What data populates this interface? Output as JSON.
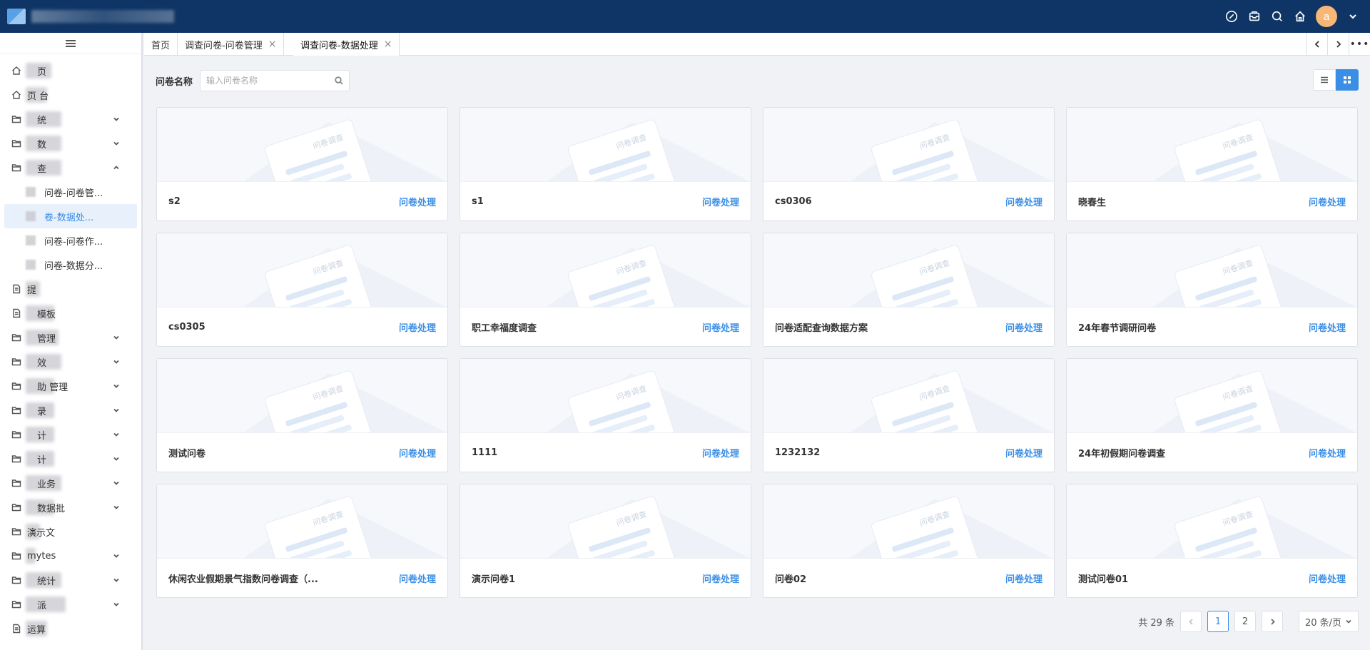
{
  "header": {
    "avatar_letter": "a",
    "icons": [
      "compass-icon",
      "inbox-icon",
      "search-icon",
      "home-icon",
      "chevron-down-icon"
    ]
  },
  "sidebar": {
    "items": [
      {
        "label": "页",
        "icon": "home-icon",
        "expandable": false
      },
      {
        "label": "页    台",
        "icon": "home-icon",
        "expandable": false
      },
      {
        "label": "统",
        "icon": "folder-icon",
        "expandable": true
      },
      {
        "label": "数",
        "icon": "folder-icon",
        "expandable": true
      },
      {
        "label": "查",
        "icon": "folder-icon",
        "expandable": true,
        "expanded": true
      },
      {
        "label": "模板",
        "icon": "document-icon",
        "expandable": false
      },
      {
        "label": "管理",
        "icon": "folder-icon",
        "expandable": true
      },
      {
        "label": "效",
        "icon": "folder-icon",
        "expandable": true
      },
      {
        "label": "助    管理",
        "icon": "folder-icon",
        "expandable": true
      },
      {
        "label": "录",
        "icon": "folder-icon",
        "expandable": true
      },
      {
        "label": "计",
        "icon": "folder-icon",
        "expandable": true
      },
      {
        "label": "计",
        "icon": "folder-icon",
        "expandable": true
      },
      {
        "label": "业务",
        "icon": "folder-icon",
        "expandable": true
      },
      {
        "label": "数据批",
        "icon": "folder-icon",
        "expandable": true
      },
      {
        "label": "演示文",
        "icon": "folder-icon",
        "expandable": false
      },
      {
        "label": "mytes",
        "icon": "folder-icon",
        "expandable": true
      },
      {
        "label": "统计",
        "icon": "folder-icon",
        "expandable": true
      },
      {
        "label": "派",
        "icon": "folder-icon",
        "expandable": true
      },
      {
        "label": "运算",
        "icon": "document-icon",
        "expandable": false
      }
    ],
    "submenu": [
      {
        "label": "问卷-问卷管...",
        "active": false
      },
      {
        "label": "卷-数据处...",
        "active": true
      },
      {
        "label": "问卷-问卷作...",
        "active": false
      },
      {
        "label": "问卷-数据分...",
        "active": false
      }
    ],
    "extra": {
      "label": "提"
    }
  },
  "tabs": [
    {
      "label": "首页",
      "closable": false
    },
    {
      "label": "调查问卷-问卷管理",
      "closable": true
    },
    {
      "label": "调查问卷-数据处理",
      "closable": true,
      "active": true
    }
  ],
  "filter": {
    "label": "问卷名称",
    "placeholder": "输入问卷名称"
  },
  "card_image_text": "问卷调查",
  "cards": [
    {
      "title": "s2",
      "action": "问卷处理"
    },
    {
      "title": "s1",
      "action": "问卷处理"
    },
    {
      "title": "cs0306",
      "action": "问卷处理"
    },
    {
      "title": "晓春生",
      "action": "问卷处理"
    },
    {
      "title": "cs0305",
      "action": "问卷处理"
    },
    {
      "title": "职工幸福度调查",
      "action": "问卷处理"
    },
    {
      "title": "问卷适配查询数据方案",
      "action": "问卷处理"
    },
    {
      "title": "24年春节调研问卷",
      "action": "问卷处理"
    },
    {
      "title": "测试问卷",
      "action": "问卷处理"
    },
    {
      "title": "1111",
      "action": "问卷处理"
    },
    {
      "title": "1232132",
      "action": "问卷处理"
    },
    {
      "title": "24年初假期问卷调查",
      "action": "问卷处理"
    },
    {
      "title": "休闲农业假期景气指数问卷调查（...",
      "action": "问卷处理"
    },
    {
      "title": "演示问卷1",
      "action": "问卷处理"
    },
    {
      "title": "问卷02",
      "action": "问卷处理"
    },
    {
      "title": "测试问卷01",
      "action": "问卷处理"
    }
  ],
  "pagination": {
    "total_text": "共 29 条",
    "pages": [
      "1",
      "2"
    ],
    "current_page": "1",
    "page_size": "20 条/页"
  },
  "colors": {
    "header_bg": "#0e3566",
    "accent": "#3a8ee6",
    "avatar_bg": "#f7b877"
  }
}
